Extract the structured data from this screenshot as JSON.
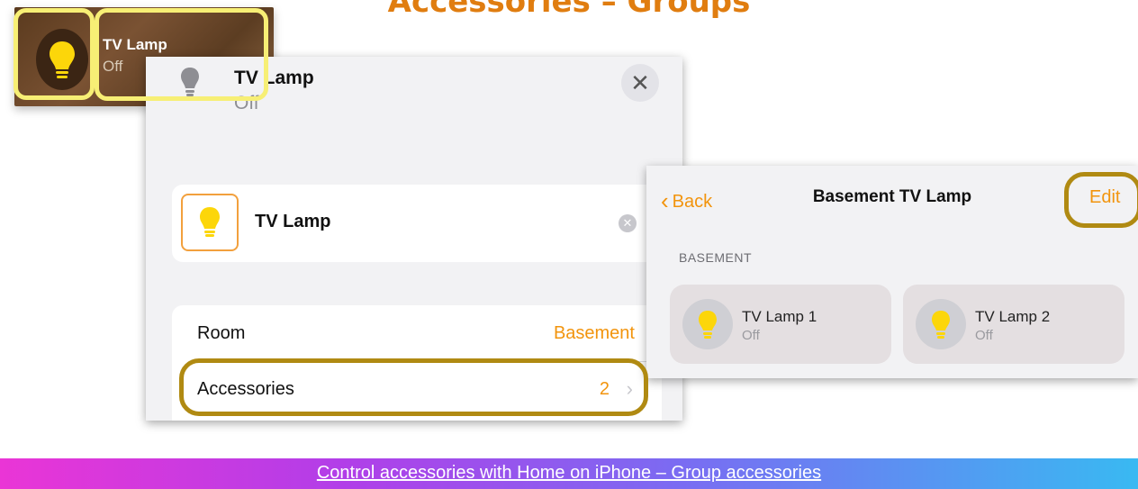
{
  "header": {
    "title": "Accessories – Groups"
  },
  "tile": {
    "name": "TV Lamp",
    "status": "Off"
  },
  "detail_panel": {
    "name": "TV Lamp",
    "status": "Off",
    "close_icon": "✕",
    "name_field": {
      "value": "TV Lamp",
      "clear_icon": "✕"
    },
    "rows": {
      "room": {
        "label": "Room",
        "value": "Basement"
      },
      "accessories": {
        "label": "Accessories",
        "value": "2",
        "chevron": "›"
      }
    }
  },
  "group_panel": {
    "back_label": "Back",
    "back_chevron": "‹",
    "title": "Basement TV Lamp",
    "edit_label": "Edit",
    "section_label": "BASEMENT",
    "accessories": [
      {
        "name": "TV Lamp 1",
        "status": "Off"
      },
      {
        "name": "TV Lamp 2",
        "status": "Off"
      }
    ]
  },
  "footer": {
    "link_text": "Control accessories with Home on iPhone – Group accessories"
  },
  "colors": {
    "accent": "#f2940d",
    "title": "#e07d10",
    "highlight_yellow": "#f7ef75",
    "highlight_gold": "#b08a12"
  },
  "icons": [
    "lightbulb-icon",
    "close-icon",
    "clear-icon",
    "chevron-right-icon",
    "chevron-left-icon"
  ]
}
